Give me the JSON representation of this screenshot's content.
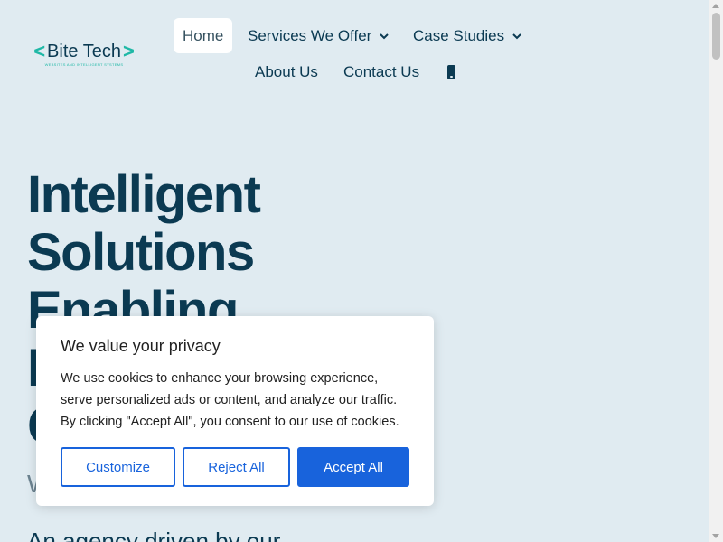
{
  "logo": {
    "left_bracket": "<",
    "name": "Bite Tech",
    "right_bracket": ">",
    "tagline": "WEBSITES AND INTELLIGENT SYSTEMS"
  },
  "nav": {
    "home": "Home",
    "services": "Services We Offer",
    "case_studies": "Case Studies",
    "about": "About Us",
    "contact": "Contact Us"
  },
  "hero": {
    "title_line1": "Intelligent",
    "title_line2": "Solutions",
    "title_line3": "Enabling",
    "title_line4": "D",
    "title_line5": "G",
    "sub": "W",
    "desc": "An agency driven by our"
  },
  "cookie": {
    "title": "We value your privacy",
    "text": "We use cookies to enhance your browsing experience, serve personalized ads or content, and analyze our traffic. By clicking \"Accept All\", you consent to our use of cookies.",
    "customize": "Customize",
    "reject": "Reject All",
    "accept": "Accept All"
  },
  "colors": {
    "background": "#e0ebf1",
    "primary_text": "#0b3a52",
    "accent": "#1fb8a6",
    "button_blue": "#1863dc"
  }
}
